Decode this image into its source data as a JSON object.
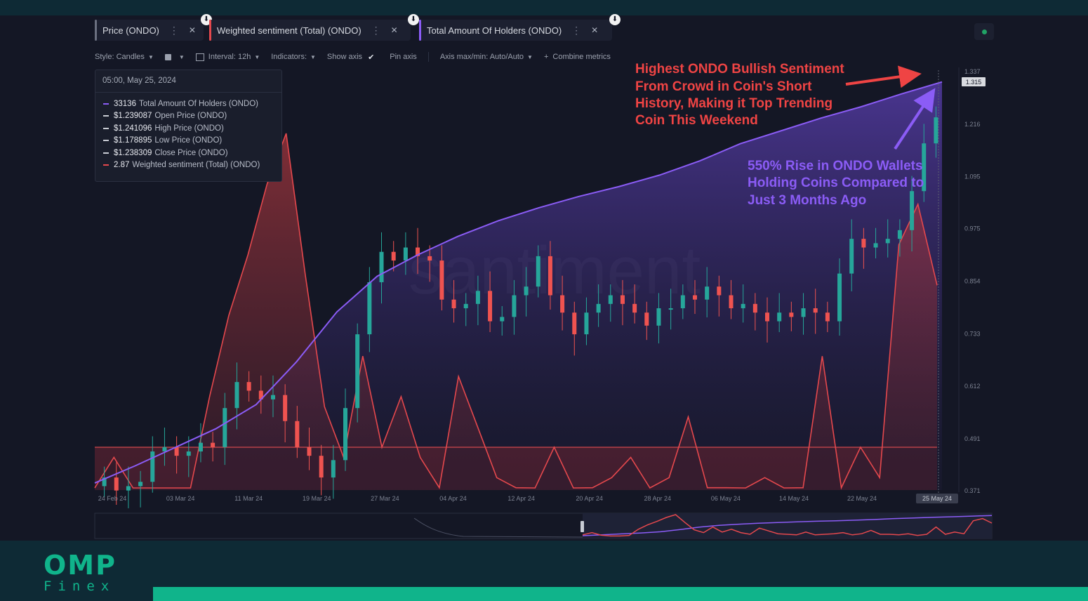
{
  "tabs": [
    {
      "label": "Price (ONDO)",
      "color": "#6b7080"
    },
    {
      "label": "Weighted sentiment (Total) (ONDO)",
      "color": "#e5484d"
    },
    {
      "label": "Total Amount Of Holders (ONDO)",
      "color": "#8b5cf6"
    }
  ],
  "toolbar": {
    "style": "Style: Candles",
    "interval": "Interval: 12h",
    "indicators": "Indicators:",
    "show_axis": "Show axis",
    "pin_axis": "Pin axis",
    "axis_maxmin": "Axis max/min: Auto/Auto",
    "combine": "Combine metrics"
  },
  "tooltip": {
    "date": "05:00, May 25, 2024",
    "rows": [
      {
        "value": "33136",
        "label": "Total Amount Of Holders (ONDO)",
        "color": "#8b5cf6"
      },
      {
        "value": "$1.239087",
        "label": "Open Price (ONDO)",
        "color": "#c9ccd4"
      },
      {
        "value": "$1.241096",
        "label": "High Price (ONDO)",
        "color": "#c9ccd4"
      },
      {
        "value": "$1.178895",
        "label": "Low Price (ONDO)",
        "color": "#c9ccd4"
      },
      {
        "value": "$1.238309",
        "label": "Close Price (ONDO)",
        "color": "#c9ccd4"
      },
      {
        "value": "2.87",
        "label": "Weighted sentiment (Total) (ONDO)",
        "color": "#e5484d"
      }
    ]
  },
  "annotations": {
    "red_text": [
      "Highest ONDO Bullish Sentiment",
      "From Crowd in Coin's Short",
      "History, Making it Top Trending",
      "Coin This Weekend"
    ],
    "purple_text": [
      "550% Rise in ONDO Wallets",
      "Holding Coins Compared to",
      "Just 3 Months Ago"
    ],
    "watermark": "santiment"
  },
  "logo": {
    "name": "OMP",
    "sub": "Finex"
  },
  "colors": {
    "up": "#26a69a",
    "down": "#ef5350",
    "sentiment": "#e5484d",
    "holders": "#8b5cf6",
    "annot_red": "#ef4444",
    "annot_purple": "#8b5cf6",
    "brand": "#10b48b"
  },
  "chart_data": {
    "type": "line",
    "x_ticks": [
      "24 Feb 24",
      "03 Mar 24",
      "11 Mar 24",
      "19 Mar 24",
      "27 Mar 24",
      "04 Apr 24",
      "12 Apr 24",
      "20 Apr 24",
      "28 Apr 24",
      "06 May 24",
      "14 May 24",
      "22 May 24"
    ],
    "hover_x_label": "25 May 24",
    "y_ticks": [
      1.337,
      1.216,
      1.095,
      0.975,
      0.854,
      0.733,
      0.612,
      0.491,
      0.371
    ],
    "y_range": [
      0.371,
      1.337
    ],
    "current_value_label": "1.315",
    "series": [
      {
        "name": "Price (ONDO)",
        "type": "candles",
        "values": [
          0.4,
          0.37,
          0.38,
          0.39,
          0.46,
          0.47,
          0.45,
          0.46,
          0.48,
          0.47,
          0.56,
          0.62,
          0.6,
          0.58,
          0.59,
          0.53,
          0.47,
          0.45,
          0.4,
          0.44,
          0.56,
          0.73,
          0.85,
          0.92,
          0.9,
          0.93,
          0.91,
          0.9,
          0.81,
          0.79,
          0.8,
          0.83,
          0.76,
          0.77,
          0.82,
          0.84,
          0.91,
          0.82,
          0.78,
          0.73,
          0.78,
          0.8,
          0.82,
          0.8,
          0.78,
          0.75,
          0.79,
          0.79,
          0.82,
          0.81,
          0.84,
          0.82,
          0.79,
          0.8,
          0.78,
          0.76,
          0.78,
          0.77,
          0.79,
          0.78,
          0.76,
          0.87,
          0.95,
          0.93,
          0.94,
          0.95,
          0.97,
          1.06,
          1.17,
          1.23
        ]
      },
      {
        "name": "Weighted sentiment (Total) (ONDO)",
        "type": "area",
        "values": [
          0.4,
          0.8,
          0.35,
          0.2,
          0.2,
          0.3,
          1.4,
          2.2,
          2.8,
          3.5,
          4.0,
          2.6,
          1.3,
          0.8,
          1.8,
          0.9,
          1.4,
          0.8,
          0.5,
          1.6,
          1.1,
          0.6,
          0.5,
          0.4,
          0.9,
          0.4,
          0.5,
          0.6,
          0.8,
          0.4,
          0.6,
          1.2,
          0.5,
          0.5,
          0.4,
          0.6,
          0.3,
          0.5,
          1.8,
          0.5,
          0.9,
          0.6,
          2.9,
          3.3,
          2.5
        ]
      },
      {
        "name": "Total Amount Of Holders (ONDO)",
        "type": "line",
        "values": [
          5000,
          6200,
          7500,
          8800,
          10500,
          13500,
          17000,
          19500,
          21000,
          22300,
          23400,
          24300,
          25100,
          25800,
          26600,
          27600,
          28800,
          29700,
          30600,
          31400,
          32300,
          33136
        ]
      }
    ]
  }
}
